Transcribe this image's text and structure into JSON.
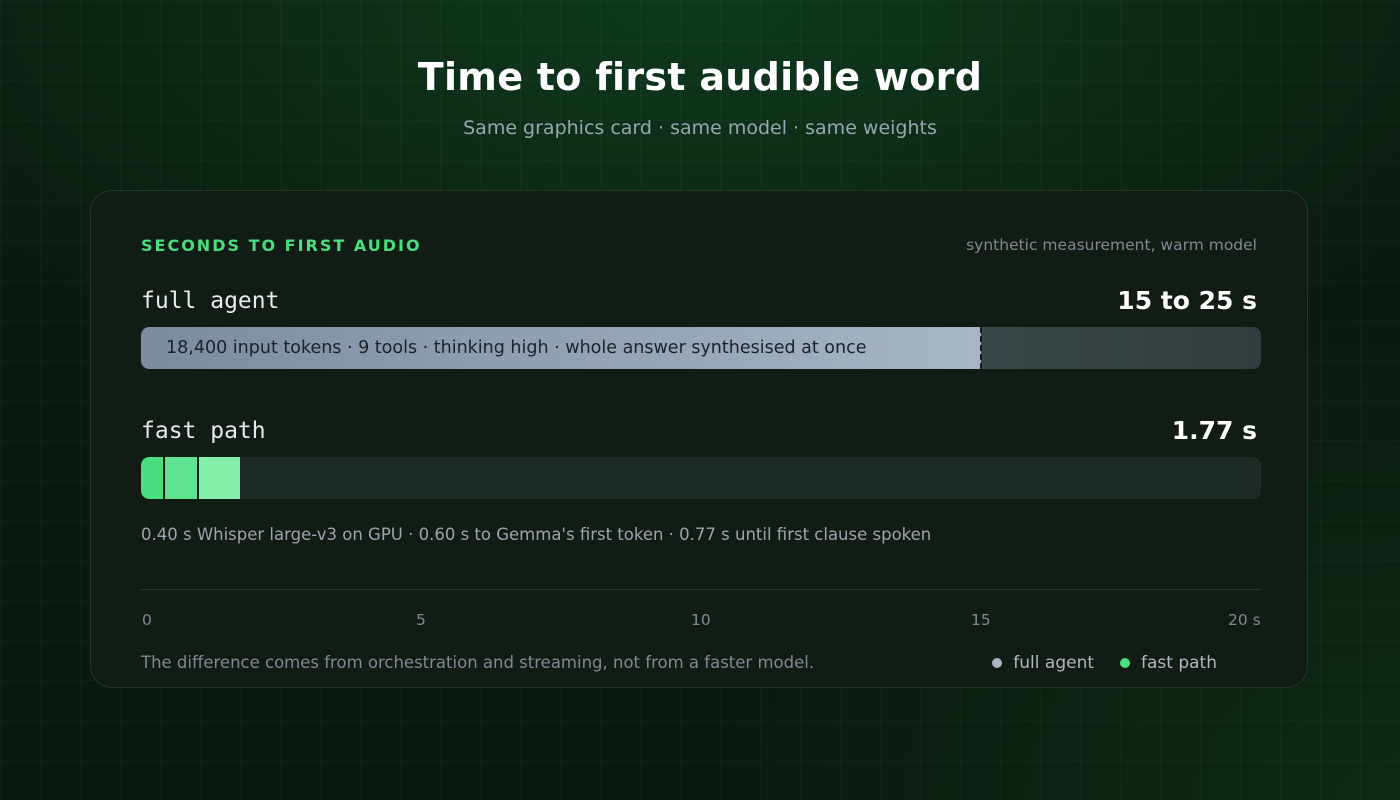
{
  "header": {
    "title": "Time to first audible word",
    "subtitle": "Same graphics card · same model · same weights"
  },
  "card": {
    "section_label": "SECONDS TO FIRST AUDIO",
    "note": "synthetic measurement, warm model",
    "footnote": "0.40 s Whisper large-v3 on GPU · 0.60 s to Gemma's first token · 0.77 s until first clause spoken",
    "bottom_note": "The difference comes from orchestration and streaming, not from a faster model."
  },
  "colors": {
    "accent": "#4ade80",
    "full_agent": "#a7b6c5",
    "fast_path_segments": [
      "#4ade80",
      "#5fe391",
      "#86efac"
    ]
  },
  "chart_data": {
    "type": "bar",
    "orientation": "horizontal",
    "xlim": [
      0,
      20
    ],
    "x_ticks": [
      "0",
      "5",
      "10",
      "15",
      "20 s"
    ],
    "x_tick_values": [
      0,
      5,
      10,
      15,
      20
    ],
    "series": [
      {
        "name": "full agent",
        "value_label": "15 to 25 s",
        "range": [
          15,
          25
        ],
        "annotation": "18,400 input tokens · 9 tools · thinking high · whole answer synthesised at once"
      },
      {
        "name": "fast path",
        "value_label": "1.77 s",
        "value": 1.77,
        "segments": [
          {
            "label": "Whisper large-v3 on GPU",
            "value": 0.4
          },
          {
            "label": "to Gemma's first token",
            "value": 0.6
          },
          {
            "label": "until first clause spoken",
            "value": 0.77
          }
        ]
      }
    ],
    "legend": [
      "full agent",
      "fast path"
    ],
    "legend_position": "bottom-right"
  }
}
